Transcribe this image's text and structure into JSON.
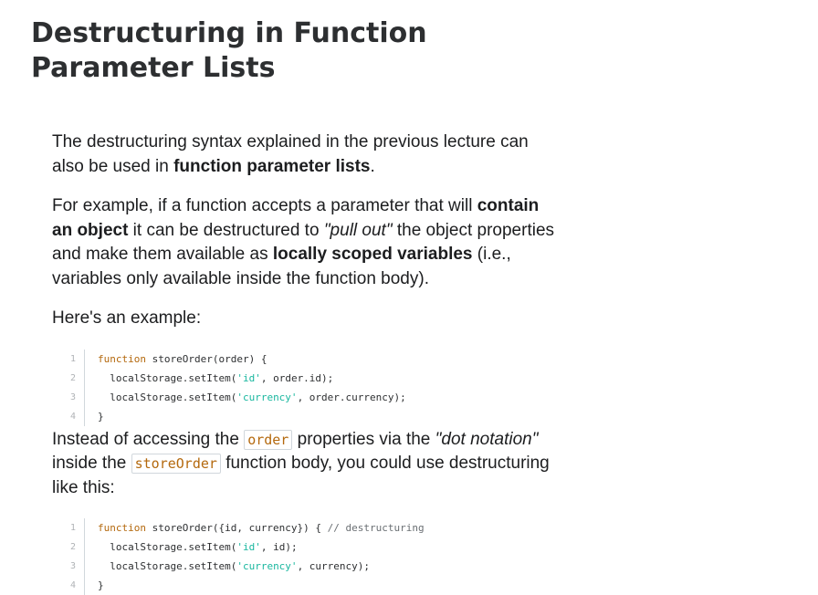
{
  "heading": "Destructuring in Function Parameter Lists",
  "para1": {
    "t1": "The destructuring syntax explained in the previous lecture can also be used in ",
    "b1": "function parameter lists",
    "t2": "."
  },
  "para2": {
    "t1": "For example, if a function accepts a parameter that will ",
    "b1": "contain an object",
    "t2": " it can be destructured to ",
    "i1": "\"pull out\"",
    "t3": " the object properties and make them available as ",
    "b2": "locally scoped variables",
    "t4": " (i.e., variables only available inside the function body)."
  },
  "para3": "Here's an example:",
  "code1": [
    {
      "n": "1",
      "parts": [
        {
          "c": "kw",
          "t": "function"
        },
        {
          "c": "",
          "t": " storeOrder(order) {"
        }
      ]
    },
    {
      "n": "2",
      "parts": [
        {
          "c": "",
          "t": "  localStorage.setItem("
        },
        {
          "c": "str",
          "t": "'id'"
        },
        {
          "c": "",
          "t": ", order.id);"
        }
      ]
    },
    {
      "n": "3",
      "parts": [
        {
          "c": "",
          "t": "  localStorage.setItem("
        },
        {
          "c": "str",
          "t": "'currency'"
        },
        {
          "c": "",
          "t": ", order.currency);"
        }
      ]
    },
    {
      "n": "4",
      "parts": [
        {
          "c": "",
          "t": "}"
        }
      ]
    }
  ],
  "para4": {
    "t1": "Instead of accessing the ",
    "c1": "order",
    "t2": " properties via the ",
    "i1": "\"dot notation\"",
    "t3": " inside the ",
    "c2": "storeOrder",
    "t4": " function body, you could use destructuring like this:"
  },
  "code2": [
    {
      "n": "1",
      "parts": [
        {
          "c": "kw",
          "t": "function"
        },
        {
          "c": "",
          "t": " storeOrder({id, currency}) { "
        },
        {
          "c": "cm",
          "t": "// destructuring"
        }
      ]
    },
    {
      "n": "2",
      "parts": [
        {
          "c": "",
          "t": "  localStorage.setItem("
        },
        {
          "c": "str",
          "t": "'id'"
        },
        {
          "c": "",
          "t": ", id);"
        }
      ]
    },
    {
      "n": "3",
      "parts": [
        {
          "c": "",
          "t": "  localStorage.setItem("
        },
        {
          "c": "str",
          "t": "'currency'"
        },
        {
          "c": "",
          "t": ", currency);"
        }
      ]
    },
    {
      "n": "4",
      "parts": [
        {
          "c": "",
          "t": "}"
        }
      ]
    }
  ]
}
